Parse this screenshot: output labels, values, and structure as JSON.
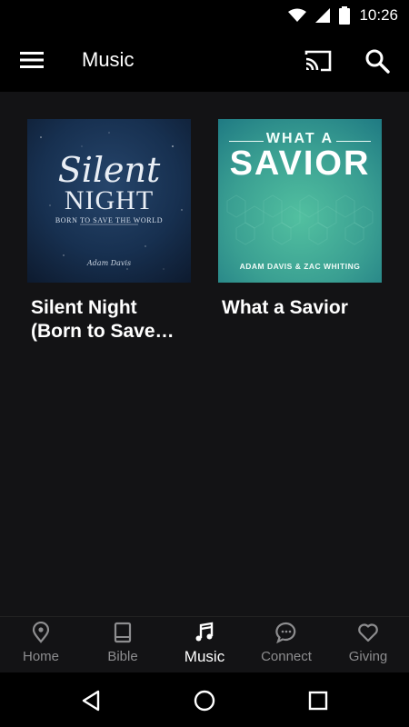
{
  "status": {
    "time": "10:26"
  },
  "app_bar": {
    "title": "Music"
  },
  "albums": [
    {
      "title": "Silent Night (Born to Save…",
      "cover_script": "Silent",
      "cover_main": "NIGHT",
      "cover_tagline": "BORN TO SAVE THE WORLD",
      "cover_signature": "Adam Davis"
    },
    {
      "title": "What a Savior",
      "cover_top": "WHAT A",
      "cover_main": "SAVIOR",
      "cover_artists": "ADAM DAVIS & ZAC WHITING"
    }
  ],
  "bottom_nav": [
    {
      "label": "Home",
      "icon": "location-pin-icon",
      "active": false
    },
    {
      "label": "Bible",
      "icon": "book-icon",
      "active": false
    },
    {
      "label": "Music",
      "icon": "music-note-icon",
      "active": true
    },
    {
      "label": "Connect",
      "icon": "chat-bubble-icon",
      "active": false
    },
    {
      "label": "Giving",
      "icon": "heart-icon",
      "active": false
    }
  ],
  "colors": {
    "active": "#ffffff",
    "inactive": "#8d8d8f",
    "background": "#131315"
  }
}
